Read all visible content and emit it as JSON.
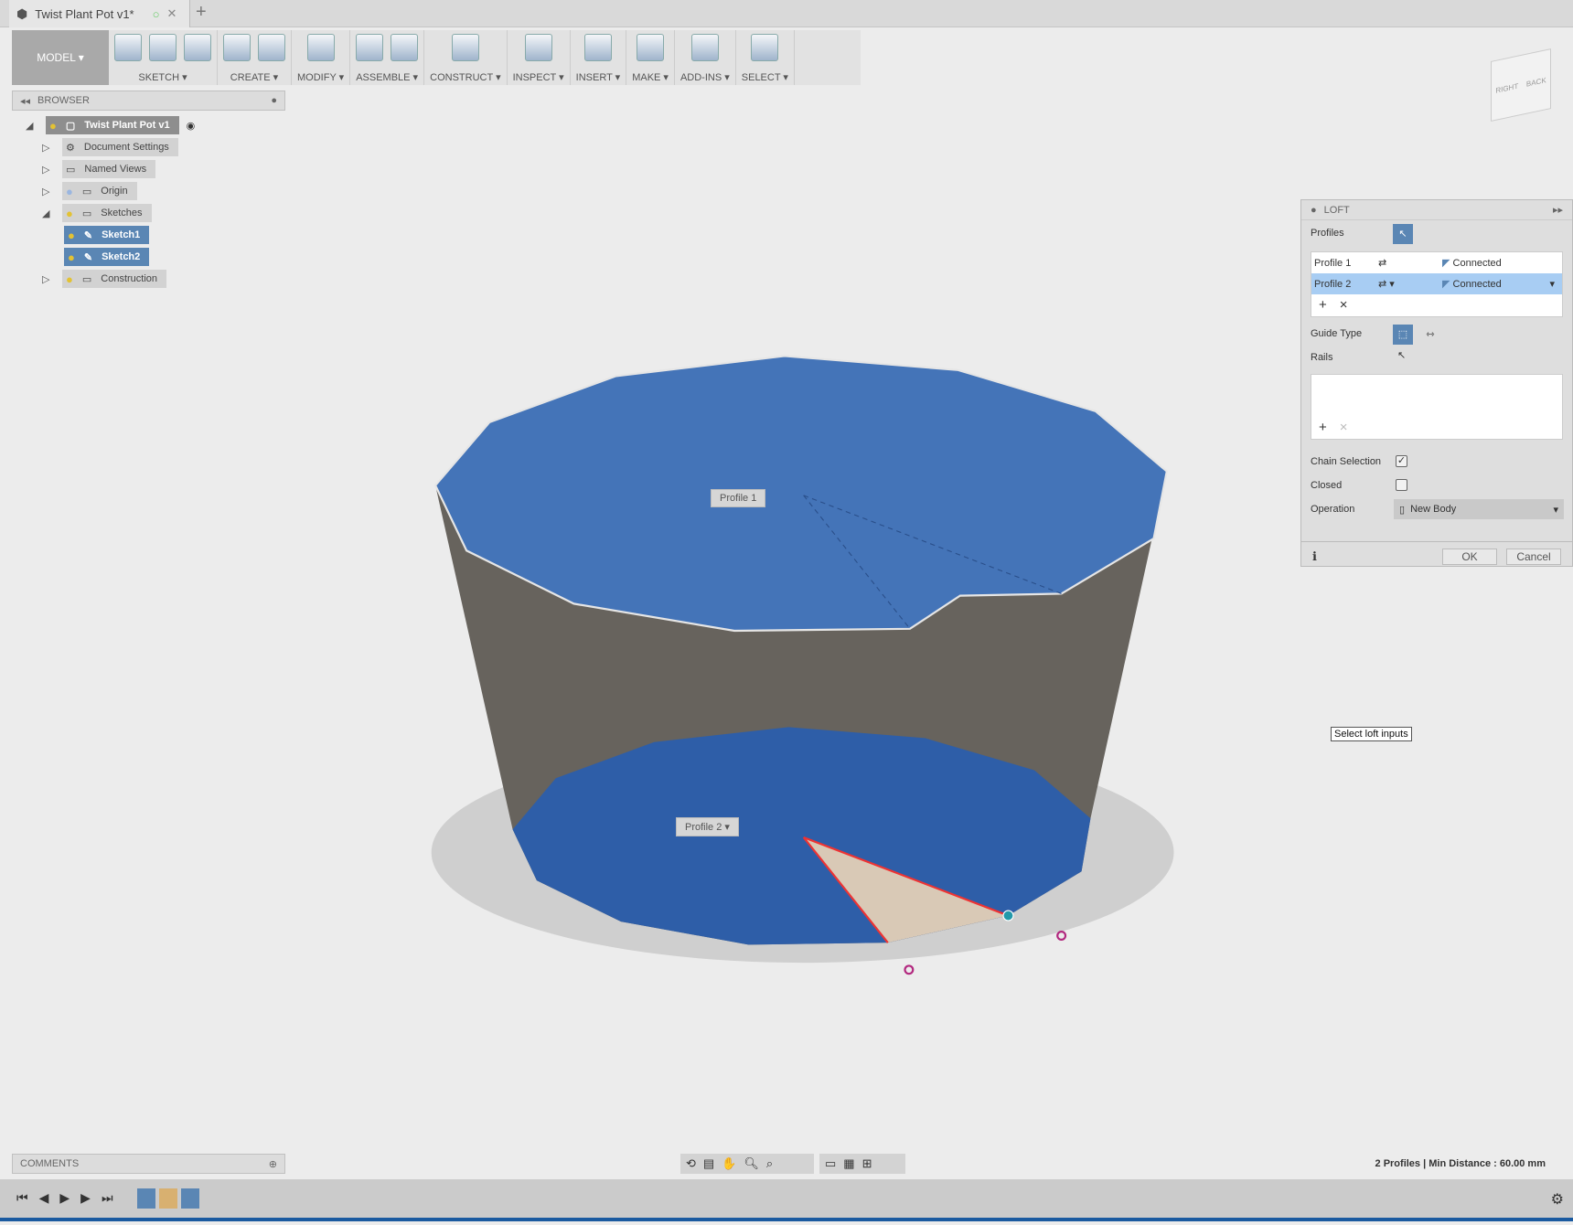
{
  "window": {
    "tab_title": "Twist Plant Pot v1*",
    "new_tab": "+"
  },
  "toolbar": {
    "model": "MODEL ▾",
    "groups": [
      {
        "label": "SKETCH ▾",
        "icons": [
          "sketch-create-icon",
          "arc-icon",
          "rectangle-icon"
        ]
      },
      {
        "label": "CREATE ▾",
        "icons": [
          "extrude-icon",
          "form-icon"
        ]
      },
      {
        "label": "MODIFY ▾",
        "icons": [
          "press-pull-icon"
        ]
      },
      {
        "label": "ASSEMBLE ▾",
        "icons": [
          "new-component-icon",
          "joint-icon"
        ]
      },
      {
        "label": "CONSTRUCT ▾",
        "icons": [
          "offset-plane-icon"
        ]
      },
      {
        "label": "INSPECT ▾",
        "icons": [
          "measure-icon"
        ]
      },
      {
        "label": "INSERT ▾",
        "icons": [
          "insert-image-icon"
        ]
      },
      {
        "label": "MAKE ▾",
        "icons": [
          "3d-print-icon"
        ]
      },
      {
        "label": "ADD-INS ▾",
        "icons": [
          "scripts-icon"
        ]
      },
      {
        "label": "SELECT ▾",
        "icons": [
          "select-icon"
        ]
      }
    ]
  },
  "browser": {
    "title": "BROWSER",
    "root": "Twist Plant Pot v1",
    "items": [
      {
        "label": "Document Settings"
      },
      {
        "label": "Named Views"
      },
      {
        "label": "Origin"
      },
      {
        "label": "Sketches"
      },
      {
        "label": "Sketch1"
      },
      {
        "label": "Sketch2"
      },
      {
        "label": "Construction"
      }
    ]
  },
  "viewport": {
    "profile1_label": "Profile 1",
    "profile2_label": "Profile 2 ▾",
    "tooltip": "Select loft inputs",
    "viewcube": {
      "right": "RIGHT",
      "back": "BACK"
    }
  },
  "loft": {
    "title": "LOFT",
    "profiles_label": "Profiles",
    "profiles": [
      {
        "name": "Profile 1",
        "end": "Connected"
      },
      {
        "name": "Profile 2",
        "end": "Connected"
      }
    ],
    "guide_type_label": "Guide Type",
    "rails_label": "Rails",
    "chain_selection_label": "Chain Selection",
    "chain_selection": true,
    "closed_label": "Closed",
    "closed": false,
    "operation_label": "Operation",
    "operation": "New Body",
    "ok": "OK",
    "cancel": "Cancel",
    "accent": "#5a86b4"
  },
  "comments": {
    "title": "COMMENTS"
  },
  "status": {
    "text": "2 Profiles | Min Distance : 60.00 mm"
  },
  "colors": {
    "face_blue": "#3f6fb5",
    "side_gray": "#6b6760",
    "selected": "#5a86b4"
  }
}
